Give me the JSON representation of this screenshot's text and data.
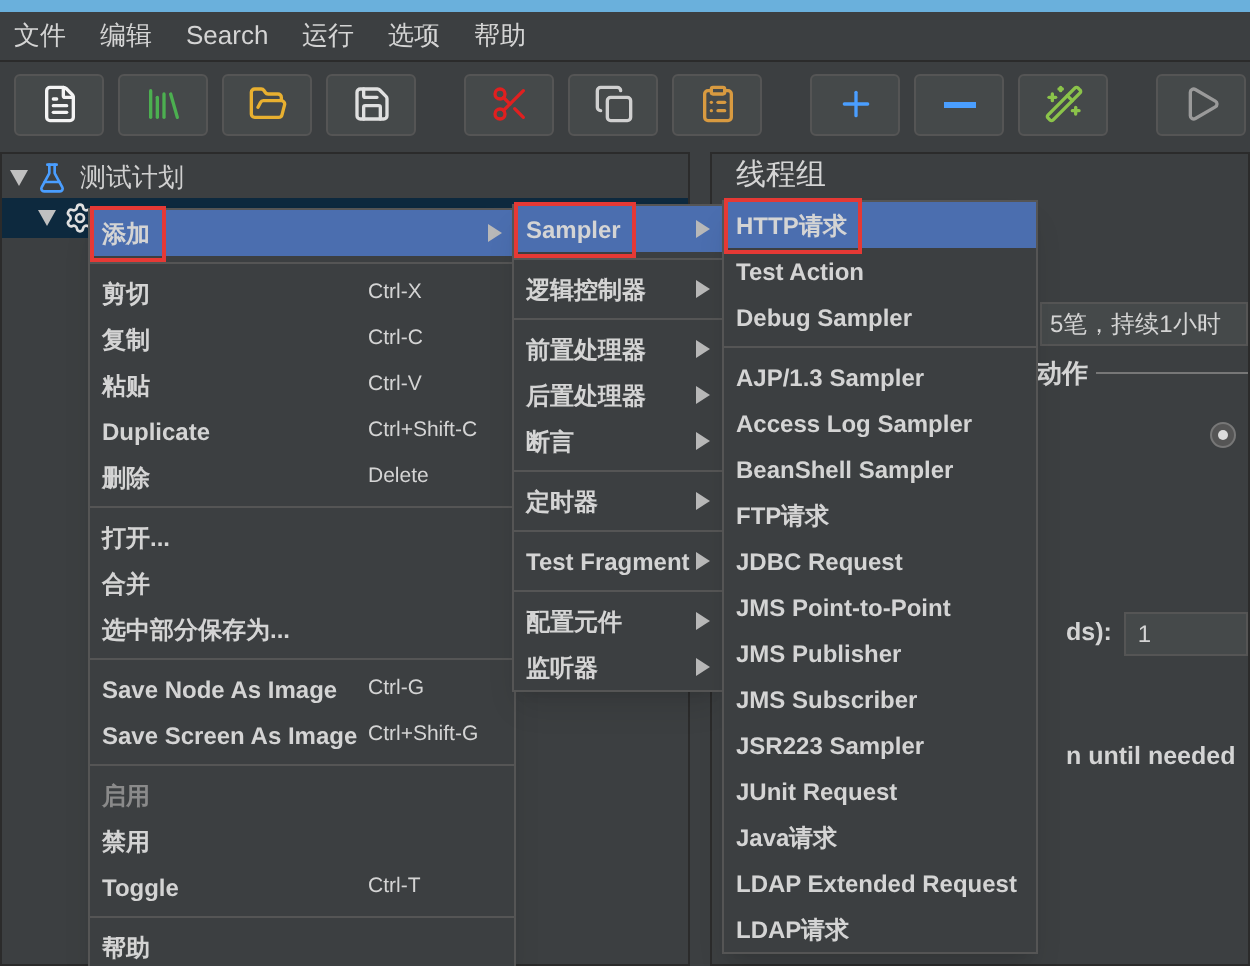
{
  "menubar": [
    {
      "label": "文件"
    },
    {
      "label": "编辑"
    },
    {
      "label": "Search"
    },
    {
      "label": "运行"
    },
    {
      "label": "选项"
    },
    {
      "label": "帮助"
    }
  ],
  "toolbar": [
    {
      "kind": "new"
    },
    {
      "kind": "templates"
    },
    {
      "kind": "open"
    },
    {
      "kind": "save"
    },
    {
      "kind": "cut"
    },
    {
      "kind": "copy"
    },
    {
      "kind": "paste"
    },
    {
      "kind": "expand"
    },
    {
      "kind": "collapse"
    },
    {
      "kind": "toggle"
    },
    {
      "kind": "start"
    }
  ],
  "tree": [
    {
      "label": "测试计划",
      "expanded": true,
      "selected": false,
      "children": [
        {
          "expanded": true,
          "selected": true
        }
      ]
    }
  ],
  "panel": {
    "title": "线程组",
    "comment": "5笔，持续1小时",
    "section": "动作",
    "radio_selected": true,
    "threads_label": "ds):",
    "threads_value": "1",
    "delay_label": "n until needed"
  },
  "context_menu": [
    {
      "kind": "item",
      "label": "添加",
      "submenu": true,
      "selected": true,
      "annotated": true,
      "disabled": false
    },
    {
      "kind": "separator"
    },
    {
      "kind": "item",
      "label": "剪切",
      "shortcut": "Ctrl-X",
      "selected": false,
      "disabled": false
    },
    {
      "kind": "item",
      "label": "复制",
      "shortcut": "Ctrl-C",
      "selected": false,
      "disabled": false
    },
    {
      "kind": "item",
      "label": "粘贴",
      "shortcut": "Ctrl-V",
      "selected": false,
      "disabled": false
    },
    {
      "kind": "item",
      "label": "Duplicate",
      "shortcut": "Ctrl+Shift-C",
      "selected": false,
      "disabled": false
    },
    {
      "kind": "item",
      "label": "删除",
      "shortcut": "Delete",
      "selected": false,
      "disabled": false
    },
    {
      "kind": "separator"
    },
    {
      "kind": "item",
      "label": "打开...",
      "selected": false,
      "disabled": false
    },
    {
      "kind": "item",
      "label": "合并",
      "selected": false,
      "disabled": false
    },
    {
      "kind": "item",
      "label": "选中部分保存为...",
      "selected": false,
      "disabled": false
    },
    {
      "kind": "separator"
    },
    {
      "kind": "item",
      "label": "Save Node As Image",
      "shortcut": "Ctrl-G",
      "selected": false,
      "disabled": false
    },
    {
      "kind": "item",
      "label": "Save Screen As Image",
      "shortcut": "Ctrl+Shift-G",
      "selected": false,
      "disabled": false
    },
    {
      "kind": "separator"
    },
    {
      "kind": "item",
      "label": "启用",
      "selected": false,
      "disabled": true
    },
    {
      "kind": "item",
      "label": "禁用",
      "selected": false,
      "disabled": false
    },
    {
      "kind": "item",
      "label": "Toggle",
      "shortcut": "Ctrl-T",
      "selected": false,
      "disabled": false
    },
    {
      "kind": "separator"
    },
    {
      "kind": "item",
      "label": "帮助",
      "selected": false,
      "disabled": false
    }
  ],
  "add_menu": [
    {
      "kind": "item",
      "label": "Sampler",
      "submenu": true,
      "selected": true,
      "annotated": true
    },
    {
      "kind": "separator"
    },
    {
      "kind": "item",
      "label": "逻辑控制器",
      "submenu": true,
      "selected": false
    },
    {
      "kind": "separator"
    },
    {
      "kind": "item",
      "label": "前置处理器",
      "submenu": true,
      "selected": false
    },
    {
      "kind": "item",
      "label": "后置处理器",
      "submenu": true,
      "selected": false
    },
    {
      "kind": "item",
      "label": "断言",
      "submenu": true,
      "selected": false
    },
    {
      "kind": "separator"
    },
    {
      "kind": "item",
      "label": "定时器",
      "submenu": true,
      "selected": false
    },
    {
      "kind": "separator"
    },
    {
      "kind": "item",
      "label": "Test Fragment",
      "submenu": true,
      "selected": false
    },
    {
      "kind": "separator"
    },
    {
      "kind": "item",
      "label": "配置元件",
      "submenu": true,
      "selected": false
    },
    {
      "kind": "item",
      "label": "监听器",
      "submenu": true,
      "selected": false
    }
  ],
  "sampler_menu": [
    {
      "kind": "item",
      "label": "HTTP请求",
      "selected": true,
      "annotated": true
    },
    {
      "kind": "item",
      "label": "Test Action",
      "selected": false
    },
    {
      "kind": "item",
      "label": "Debug Sampler",
      "selected": false
    },
    {
      "kind": "separator"
    },
    {
      "kind": "item",
      "label": "AJP/1.3 Sampler",
      "selected": false
    },
    {
      "kind": "item",
      "label": "Access Log Sampler",
      "selected": false
    },
    {
      "kind": "item",
      "label": "BeanShell Sampler",
      "selected": false
    },
    {
      "kind": "item",
      "label": "FTP请求",
      "selected": false
    },
    {
      "kind": "item",
      "label": "JDBC Request",
      "selected": false
    },
    {
      "kind": "item",
      "label": "JMS Point-to-Point",
      "selected": false
    },
    {
      "kind": "item",
      "label": "JMS Publisher",
      "selected": false
    },
    {
      "kind": "item",
      "label": "JMS Subscriber",
      "selected": false
    },
    {
      "kind": "item",
      "label": "JSR223 Sampler",
      "selected": false
    },
    {
      "kind": "item",
      "label": "JUnit Request",
      "selected": false
    },
    {
      "kind": "item",
      "label": "Java请求",
      "selected": false
    },
    {
      "kind": "item",
      "label": "LDAP Extended Request",
      "selected": false
    },
    {
      "kind": "item",
      "label": "LDAP请求",
      "selected": false
    }
  ]
}
